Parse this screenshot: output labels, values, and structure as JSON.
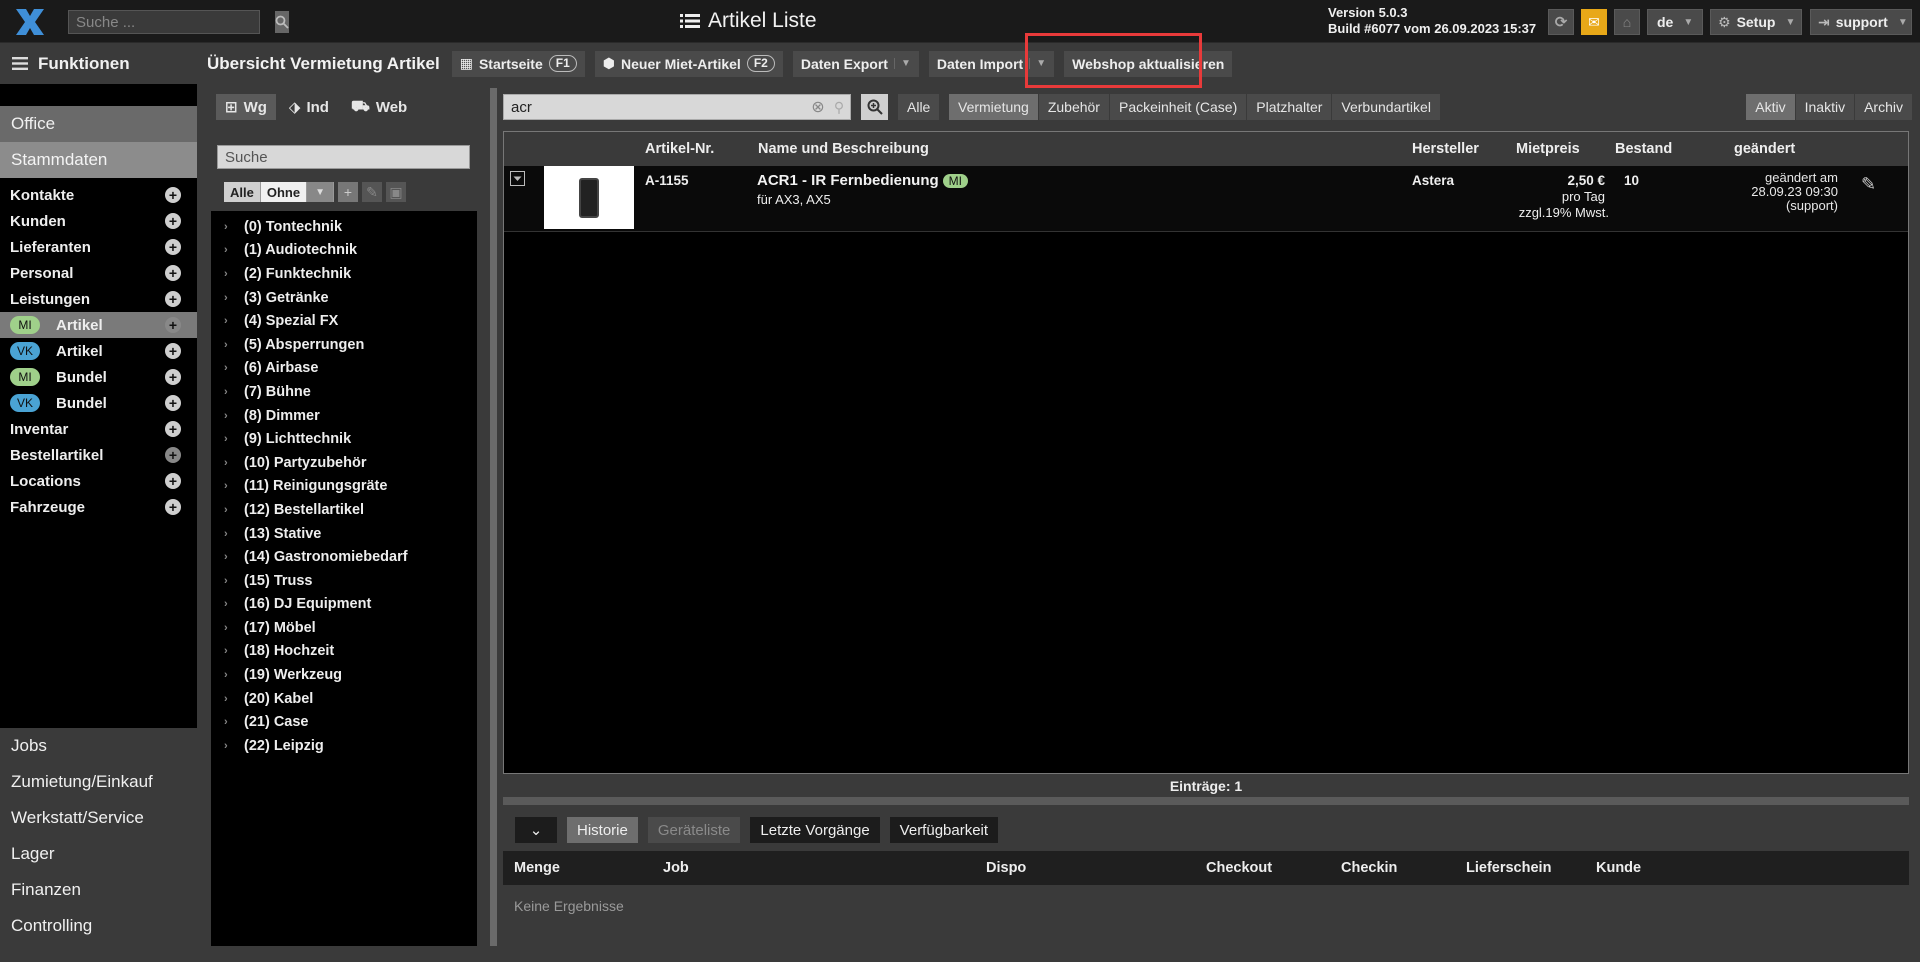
{
  "topbar": {
    "search_placeholder": "Suche ...",
    "title": "Artikel Liste",
    "version_line1": "Version 5.0.3",
    "version_line2": "Build #6077 vom 26.09.2023 15:37",
    "language": "de",
    "setup_label": "Setup",
    "user_label": "support"
  },
  "sidebar": {
    "header": "Funktionen",
    "sections": {
      "office": "Office",
      "stammdaten": "Stammdaten"
    },
    "items": [
      {
        "label": "Kontakte",
        "badge": ""
      },
      {
        "label": "Kunden",
        "badge": ""
      },
      {
        "label": "Lieferanten",
        "badge": ""
      },
      {
        "label": "Personal",
        "badge": ""
      },
      {
        "label": "Leistungen",
        "badge": ""
      },
      {
        "label": "Artikel",
        "badge": "MI",
        "active": true
      },
      {
        "label": "Artikel",
        "badge": "VK"
      },
      {
        "label": "Bundel",
        "badge": "MI"
      },
      {
        "label": "Bundel",
        "badge": "VK"
      },
      {
        "label": "Inventar",
        "badge": ""
      },
      {
        "label": "Bestellartikel",
        "badge": ""
      },
      {
        "label": "Locations",
        "badge": ""
      },
      {
        "label": "Fahrzeuge",
        "badge": ""
      }
    ],
    "bottom_sections": [
      "Jobs",
      "Zumietung/Einkauf",
      "Werkstatt/Service",
      "Lager",
      "Finanzen",
      "Controlling"
    ]
  },
  "toolbar": {
    "title": "Übersicht Vermietung Artikel",
    "startseite": "Startseite",
    "startseite_key": "F1",
    "new_article": "Neuer Miet-Artikel",
    "new_article_key": "F2",
    "export": "Daten Export",
    "import": "Daten Import",
    "webshop": "Webshop aktualisieren"
  },
  "categories": {
    "tabs": [
      "Wg",
      "Ind",
      "Web"
    ],
    "search_placeholder": "Suche",
    "filter_all": "Alle",
    "filter_without": "Ohne",
    "items": [
      "(0) Tontechnik",
      "(1) Audiotechnik",
      "(2) Funktechnik",
      "(3) Getränke",
      "(4) Spezial FX",
      "(5) Absperrungen",
      "(6) Airbase",
      "(7) Bühne",
      "(8) Dimmer",
      "(9) Lichttechnik",
      "(10) Partyzubehör",
      "(11) Reinigungsgräte",
      "(12) Bestellartikel",
      "(13) Stative",
      "(14) Gastronomiebedarf",
      "(15) Truss",
      "(16) DJ Equipment",
      "(17) Möbel",
      "(18) Hochzeit",
      "(19) Werkzeug",
      "(20) Kabel",
      "(21) Case",
      "(22) Leipzig"
    ]
  },
  "filters": {
    "search_value": "acr",
    "all": "Alle",
    "types": [
      "Vermietung",
      "Zubehör",
      "Packeinheit (Case)",
      "Platzhalter",
      "Verbundartikel"
    ],
    "states": [
      "Aktiv",
      "Inaktiv",
      "Archiv"
    ]
  },
  "table": {
    "headers": [
      "Artikel-Nr.",
      "Name und Beschreibung",
      "Hersteller",
      "Mietpreis",
      "Bestand",
      "geändert"
    ],
    "rows": [
      {
        "nr": "A-1155",
        "name": "ACR1 - IR Fernbedienung",
        "tag": "MI",
        "desc": "für AX3, AX5",
        "manufacturer": "Astera",
        "price": "2,50 €",
        "price_unit": "pro Tag",
        "price_tax": "zzgl.19% Mwst.",
        "stock": "10",
        "changed_1": "geändert am",
        "changed_2": "28.09.23 09:30",
        "changed_3": "(support)"
      }
    ],
    "entries": "Einträge: 1"
  },
  "bottom": {
    "tabs": [
      "Historie",
      "Geräteliste",
      "Letzte Vorgänge",
      "Verfügbarkeit"
    ],
    "headers": [
      "Menge",
      "Job",
      "Dispo",
      "Checkout",
      "Checkin",
      "Lieferschein",
      "Kunde"
    ],
    "empty": "Keine Ergebnisse"
  },
  "colors": {
    "accent_green": "#9fd08a",
    "accent_blue": "#4aa3d4",
    "highlight": "#e83a3a"
  }
}
